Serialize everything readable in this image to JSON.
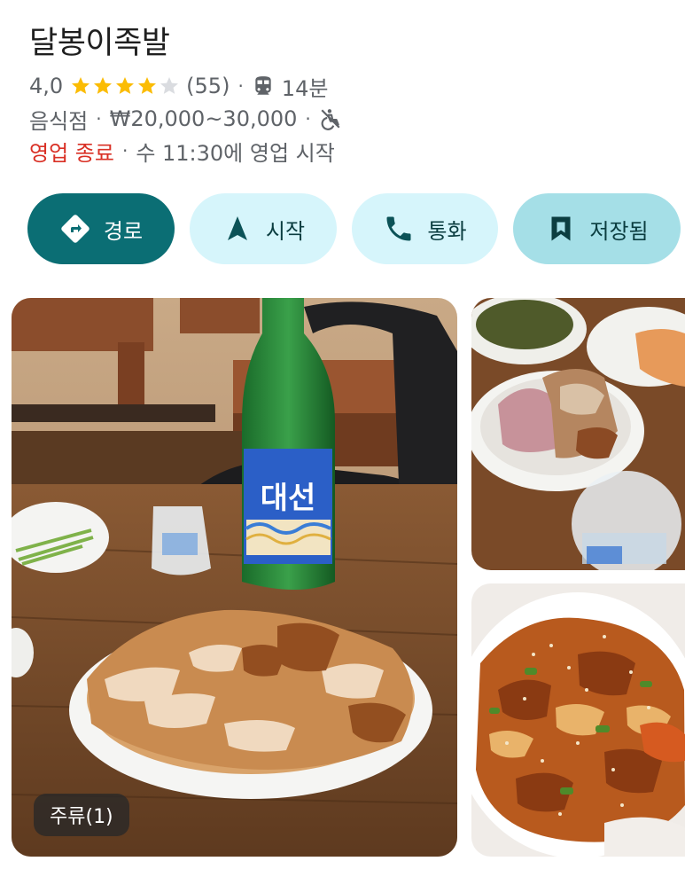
{
  "place": {
    "name": "달봉이족발",
    "rating": "4,0",
    "stars_filled": 4,
    "stars_total": 5,
    "review_count": "(55)",
    "transit_icon": "train-icon",
    "transit_time": "14분",
    "category": "음식점",
    "price_range": "₩20,000~30,000",
    "accessibility_icon": "no-wheelchair-icon",
    "status": "영업 종료",
    "next_open": "수 11:30에 영업 시작"
  },
  "actions": {
    "route": {
      "label": "경로",
      "icon": "directions-icon"
    },
    "start": {
      "label": "시작",
      "icon": "navigation-arrow-icon"
    },
    "call": {
      "label": "통화",
      "icon": "phone-icon"
    },
    "saved": {
      "label": "저장됨",
      "icon": "bookmark-icon"
    }
  },
  "photos": {
    "main_badge": "주류(1)",
    "bottle_label": "대선"
  },
  "colors": {
    "accent": "#0b6e74",
    "button_light": "#d6f5fb",
    "button_saved": "#a5dfe7",
    "star": "#fbbc04",
    "closed": "#d93025"
  }
}
